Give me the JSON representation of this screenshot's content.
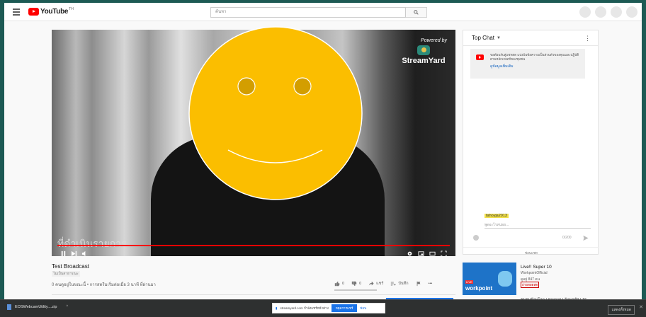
{
  "header": {
    "logo_text": "YouTube",
    "logo_sup": "TH",
    "search_placeholder": "ค้นหา"
  },
  "player": {
    "stream_powered": "Powered by",
    "stream_name": "StreamYard",
    "overlay_text": "ที่ดำเนินรายการ"
  },
  "video": {
    "title": "Test Broadcast",
    "category": "ไม่เป็นสาธารณะ",
    "views_line": "0 คนดูอยู่ในขณะนี้ • การสตรีมเริ่มต่อเมื่อ 3 นาที ที่ผ่านมา",
    "likes": "0",
    "dislikes": "0",
    "share_label": "แชร์",
    "save_label": "บันทึก"
  },
  "chat": {
    "header_label": "Top Chat",
    "notice_text": "ขอต้อนรับสู่แชทสด แบ่งปันข้อความเป็นส่วนตัวของคุณและปฏิบัติตามหลักเกณฑ์ของชุมชน",
    "notice_link": "ดูข้อมูลเพิ่มเติม",
    "username": "tahoyja2013",
    "input_placeholder": "พูดอะไรหน่อย...",
    "char_count": "0/200",
    "hide_label": "ซ่อนแชท"
  },
  "suggestion": {
    "title": "Live!! Super 10",
    "channel": "WorkpointOfficial",
    "viewers": "ดูอยู่ 847 คน",
    "badge": "ถ่ายทอดสด",
    "thumb_brand": "workpoint",
    "thumb_live": "LIVE",
    "next_title": "ชมรมข้ามโลก | รายการ | วันพฤหัส | 16"
  },
  "download_bar": {
    "file_name": "EOSWebcamUtility....zip",
    "show_all": "แสดงทั้งหมด"
  },
  "snackbar": {
    "text": "streamyard.com กำลังแชร์หน้าต่าง",
    "stop_label": "หยุดการแชร์",
    "hide_label": "ซ่อน"
  },
  "colors": {
    "brand": "#ff0000",
    "accent": "#1a73e8",
    "smiley": "#fbbe00"
  }
}
